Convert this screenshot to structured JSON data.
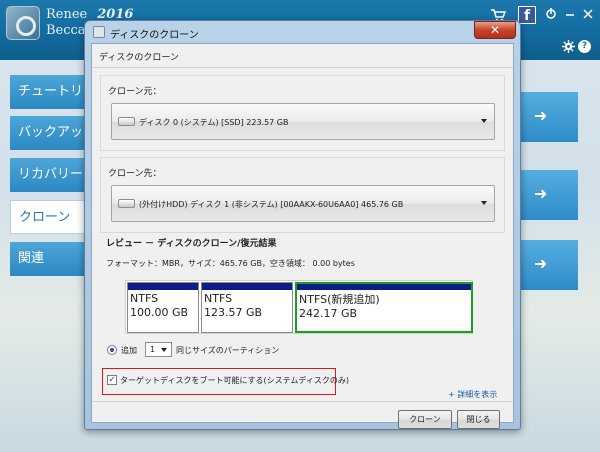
{
  "app": {
    "title_line1": "Renee",
    "title_line2": "Becca",
    "year": "2016",
    "facebook_glyph": "f",
    "icons": [
      "cart-icon",
      "facebook-icon",
      "share-icon",
      "minimize-icon",
      "close-icon",
      "settings-icon",
      "help-icon"
    ]
  },
  "nav": {
    "items": [
      {
        "label": "チュートリアル",
        "active": false
      },
      {
        "label": "バックアップ",
        "active": false
      },
      {
        "label": "リカバリー",
        "active": false
      },
      {
        "label": "クローン",
        "active": true
      },
      {
        "label": "関連",
        "active": false
      }
    ]
  },
  "dialog": {
    "title": "ディスクのクローン",
    "close_glyph": "✕",
    "heading": "ディスクのクローン",
    "source": {
      "label": "クローン元：",
      "value": "ディスク 0 (システム) [SSD]   223.57 GB"
    },
    "target": {
      "label": "クローン先：",
      "value": "(外付けHDD) ディスク 1 (非システム) [00AAKX-60U6AA0]    465.76 GB"
    },
    "review": {
      "title": "レビュー － ディスクのクローン/復元結果",
      "info": "フォーマット：MBR，サイズ：465.76 GB，空き領域： 0.00 bytes",
      "partitions": [
        {
          "fs": "NTFS",
          "size": "100.00 GB"
        },
        {
          "fs": "NTFS",
          "size": "123.57 GB"
        },
        {
          "fs": "NTFS(新規追加)",
          "size": "242.17 GB"
        }
      ]
    },
    "add": {
      "label": "追加",
      "count": "1",
      "suffix": "同じサイズのパーティション"
    },
    "bootable": {
      "label": "ターゲットディスクをブート可能にする(システムディスクのみ)",
      "checked": true
    },
    "details_link": "+ 詳細を表示",
    "buttons": {
      "clone": "クローン",
      "close": "閉じる"
    }
  },
  "colors": {
    "accent": "#2b88c2",
    "highlight": "#e0181c",
    "new_partition": "#16a31c",
    "partition_bar": "#0d1c8a"
  }
}
